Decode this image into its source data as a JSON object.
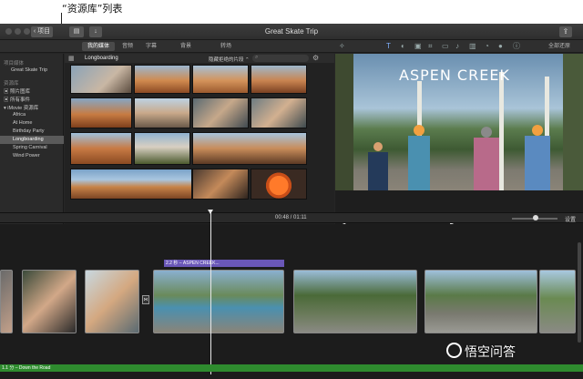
{
  "annotation": {
    "label": "“资源库”列表"
  },
  "window": {
    "back_label": "项目",
    "title": "Great Skate Trip"
  },
  "tabs": [
    "我的媒体",
    "音频",
    "字幕",
    "背景",
    "转场"
  ],
  "reset_all": "全部还原",
  "sidebar": {
    "project_head": "项目媒体",
    "project_item": "Great Skate Trip",
    "library_head": "资源库",
    "items": [
      "照片图库",
      "所有事件",
      "iMovie 资源库",
      "Africa",
      "At Home",
      "Birthday Party",
      "Longboarding",
      "Spring Carnival",
      "Wind Power"
    ],
    "selected_index": 6
  },
  "browser": {
    "title": "Longboarding",
    "filter_label": "隐藏拒绝的片段 ⌃"
  },
  "viewer": {
    "overlay_title": "ASPEN CREEK"
  },
  "timeline": {
    "timecode": "00:48 / 01:11",
    "settings_label": "设置",
    "title_clip": "2.2 秒 – ASPEN CREEK...",
    "audio_clip": "1.1 分 – Down the Road"
  },
  "watermark": {
    "text": "悟空问答"
  },
  "colors": {
    "accent_title_clip": "#6a57b8",
    "audio_track": "#2e8b2e",
    "selected_sidebar": "#5a5a5a"
  }
}
